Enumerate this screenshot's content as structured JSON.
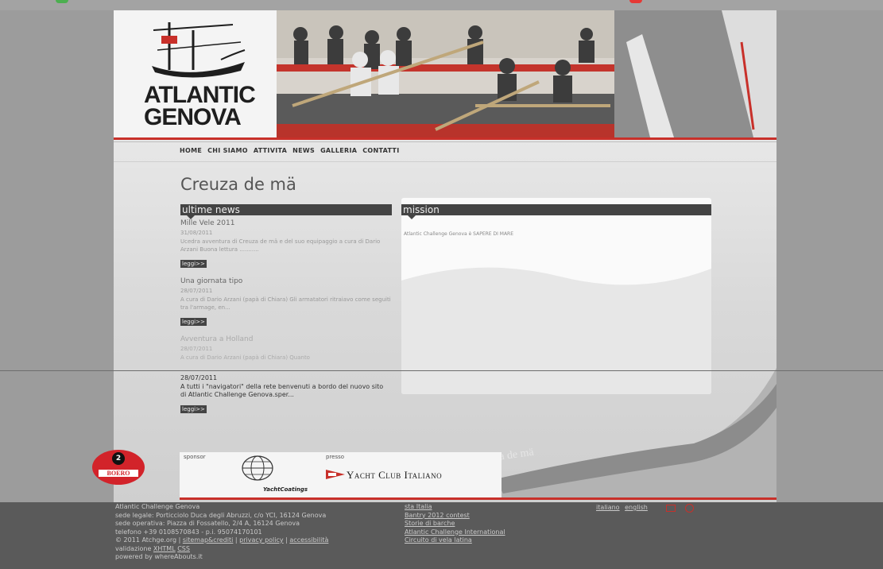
{
  "site": {
    "logo_line1": "ATLANTIC",
    "logo_line2": "GENOVA"
  },
  "nav": {
    "items": [
      "HOME",
      "CHI SIAMO",
      "ATTIVITA",
      "NEWS",
      "GALLERIA",
      "CONTATTI"
    ]
  },
  "page": {
    "title": "Creuza de mä"
  },
  "news": {
    "heading": "ultime news",
    "more_label": "leggi>>",
    "items": [
      {
        "title": "Mille Vele 2011",
        "date": "31/08/2011",
        "excerpt": "Ucedra avventura di Creuza de mä e del suo equipaggio a cura di Dario Arzani Buona lettura ..........."
      },
      {
        "title": "Una giornata tipo",
        "date": "28/07/2011",
        "excerpt": "A cura di Dario Arzani (papà di Chiara) Gli armatatori ritraiavo come seguiti tra l'armage, en..."
      },
      {
        "title": "Avventura a Holland",
        "date": "28/07/2011",
        "excerpt": "A cura di Dario Arzani (papà di Chiara) Quanto"
      }
    ],
    "bright_item": {
      "date": "28/07/2011",
      "excerpt": "A tutti i \"navigatori\" della rete benvenuti a bordo del nuovo sito di Atlantic Challenge Genova.sper..."
    }
  },
  "mission": {
    "heading": "mission",
    "text": "Atlantic Challenge Genova è SAPERE DI MARE"
  },
  "sponsor": {
    "sponsor_label": "sponsor",
    "presso_label": "presso",
    "boero": "BOERO",
    "boero_badge": "2",
    "yacht_coatings": "YachtCoatings",
    "yci": "Yacht Club Italiano",
    "boat_name": "Creuza de mä"
  },
  "footer": {
    "col1": [
      "Atlantic Challenge Genova",
      "sede legale: Porticciolo Duca degli Abruzzi, c/o YCI, 16124 Genova",
      "sede operativa: Piazza di Fossatello, 2/4 A, 16124 Genova",
      "telefono +39 0108570843 - p.i. 95074170101"
    ],
    "copyright": "© 2011 Atchge.org",
    "sitemap": "sitemap&crediti",
    "privacy": "privacy policy",
    "accessibility": "accessibilità",
    "validation_label": "validazione",
    "xhtml": "XHTML",
    "css": "CSS",
    "powered": "powered by whereAbouts.it",
    "col2": [
      "sta Italia",
      "Bantry 2012 contest",
      "Storie di barche",
      "Atlantic Challenge International",
      "Circuito di vela latina"
    ],
    "lang_it": "italiano",
    "lang_en": "english"
  },
  "colors": {
    "accent": "#c8302a",
    "dark_header": "#444444",
    "footer_bg": "#5a5a5a"
  }
}
